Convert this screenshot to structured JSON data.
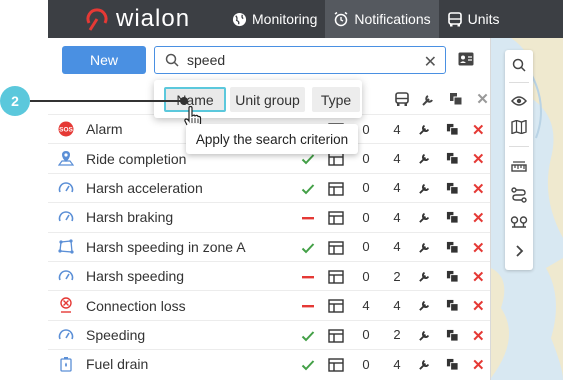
{
  "app": {
    "logo_text": "wialon"
  },
  "nav": [
    {
      "label": "Monitoring",
      "icon": "globe-icon"
    },
    {
      "label": "Notifications",
      "icon": "alarm-clock-icon",
      "active": true
    },
    {
      "label": "Units",
      "icon": "car-icon"
    }
  ],
  "toolbar": {
    "new_label": "New"
  },
  "search": {
    "value": "speed",
    "clear": "✕"
  },
  "popup": {
    "options": [
      "Name",
      "Unit group",
      "Type"
    ],
    "selected": "Name",
    "tooltip": "Apply the search criterion"
  },
  "callout": {
    "number": "2"
  },
  "rows": [
    {
      "name": "Alarm",
      "icon": "sos-icon",
      "status": "enabled",
      "n1": "0",
      "n2": "4"
    },
    {
      "name": "Ride completion",
      "icon": "map-pin-icon",
      "status": "enabled",
      "n1": "0",
      "n2": "4"
    },
    {
      "name": "Harsh acceleration",
      "icon": "speedometer-icon",
      "status": "enabled",
      "n1": "0",
      "n2": "4"
    },
    {
      "name": "Harsh braking",
      "icon": "speedometer-icon",
      "status": "disabled",
      "n1": "0",
      "n2": "4"
    },
    {
      "name": "Harsh speeding in zone A",
      "icon": "geofence-icon",
      "status": "enabled",
      "n1": "0",
      "n2": "4"
    },
    {
      "name": "Harsh speeding",
      "icon": "speedometer-icon",
      "status": "disabled",
      "n1": "0",
      "n2": "2"
    },
    {
      "name": "Connection loss",
      "icon": "connection-loss-icon",
      "status": "disabled",
      "n1": "4",
      "n2": "4"
    },
    {
      "name": "Speeding",
      "icon": "speedometer-icon",
      "status": "enabled",
      "n1": "0",
      "n2": "2"
    },
    {
      "name": "Fuel drain",
      "icon": "fuel-icon",
      "status": "enabled",
      "n1": "0",
      "n2": "4"
    }
  ],
  "colors": {
    "accent": "#4a90e2",
    "highlight": "#5bc8dc",
    "enabled": "#43a047",
    "disabled": "#e53935",
    "topbar": "#3c3f44"
  }
}
